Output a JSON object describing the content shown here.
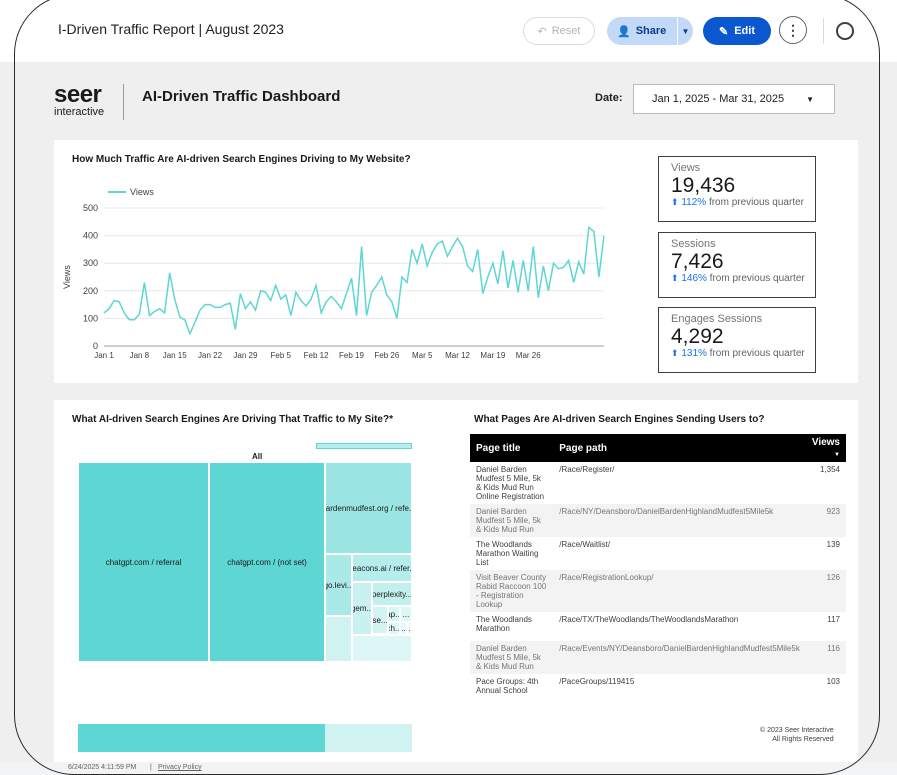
{
  "topbar": {
    "report_title": "I-Driven Traffic Report | August 2023",
    "reset_label": "Reset",
    "share_label": "Share",
    "edit_label": "Edit"
  },
  "header": {
    "logo_main": "seer",
    "logo_sub": "interactive",
    "title": "AI-Driven Traffic Dashboard",
    "date_label": "Date:",
    "date_range": "Jan 1, 2025 - Mar 31, 2025"
  },
  "traffic": {
    "section_title": "How Much Traffic Are AI-driven Search Engines Driving to My Website?"
  },
  "kpis": [
    {
      "label": "Views",
      "value": "19,436",
      "delta": "112%",
      "suffix": " from previous quarter"
    },
    {
      "label": "Sessions",
      "value": "7,426",
      "delta": "146%",
      "suffix": " from previous quarter"
    },
    {
      "label": "Engages Sessions",
      "value": "4,292",
      "delta": "131%",
      "suffix": " from previous quarter"
    }
  ],
  "chart_data": {
    "type": "line",
    "series": [
      {
        "name": "Views",
        "values": [
          120,
          135,
          165,
          160,
          120,
          95,
          95,
          115,
          230,
          110,
          125,
          135,
          120,
          265,
          170,
          105,
          95,
          45,
          85,
          130,
          150,
          150,
          140,
          140,
          150,
          155,
          60,
          190,
          135,
          160,
          130,
          200,
          195,
          165,
          220,
          170,
          185,
          110,
          195,
          165,
          145,
          170,
          220,
          120,
          160,
          180,
          160,
          135,
          190,
          245,
          110,
          360,
          110,
          195,
          220,
          250,
          185,
          160,
          100,
          250,
          230,
          350,
          300,
          370,
          290,
          340,
          370,
          380,
          325,
          360,
          390,
          360,
          290,
          270,
          350,
          190,
          250,
          300,
          225,
          345,
          210,
          310,
          195,
          310,
          200,
          360,
          175,
          290,
          200,
          300,
          280,
          285,
          310,
          230,
          305,
          260,
          430,
          415,
          250,
          400
        ],
        "color": "#5dd6d4"
      }
    ],
    "x_ticks": [
      "Jan 1",
      "Jan 8",
      "Jan 15",
      "Jan 22",
      "Jan 29",
      "Feb 5",
      "Feb 12",
      "Feb 19",
      "Feb 26",
      "Mar 5",
      "Mar 12",
      "Mar 19",
      "Mar 26"
    ],
    "y_ticks": [
      0,
      100,
      200,
      300,
      400,
      500
    ],
    "ylim": [
      0,
      500
    ],
    "ylabel": "Views",
    "legend": "top-left"
  },
  "engines": {
    "section_title": "What AI-driven Search Engines Are Driving That Traffic to My Site?*",
    "all_label": "All",
    "tiles": [
      "chatgpt.com / referral",
      "chatgpt.com / (not set)",
      "bardenmudfest.org / refe...",
      "beacons.ai / refer...",
      "go.levi...",
      "perplexity...",
      "gem...",
      "se...",
      "ap...",
      "...",
      "ch...",
      "|...",
      "..."
    ]
  },
  "pages": {
    "section_title": "What Pages Are AI-driven Search Engines Sending Users to?",
    "columns": [
      "Page title",
      "Page path",
      "Views"
    ],
    "rows": [
      {
        "title": "Daniel Barden Mudfest 5 Mile, 5k & Kids Mud Run Online Registration",
        "path": "/Race/Register/",
        "views": "1,354"
      },
      {
        "title": "Daniel Barden Mudfest 5 Mile, 5k & Kids Mud Run",
        "path": "/Race/NY/Deansboro/DanielBardenHighlandMudfest5Mile5k",
        "views": "923"
      },
      {
        "title": "The Woodlands Marathon Waiting List",
        "path": "/Race/Waitlist/",
        "views": "139"
      },
      {
        "title": "Visit Beaver County Rabid Raccoon 100 - Registration Lookup",
        "path": "/Race/RegistrationLookup/",
        "views": "126"
      },
      {
        "title": "The Woodlands Marathon",
        "path": "/Race/TX/TheWoodlands/TheWoodlandsMarathon",
        "views": "117"
      },
      {
        "title": "Daniel Barden Mudfest 5 Mile, 5k & Kids Mud Run",
        "path": "/Race/Events/NY/Deansboro/DanielBardenHighlandMudfest5Mile5k",
        "views": "116"
      },
      {
        "title": "Pace Groups: 4th Annual School",
        "path": "/PaceGroups/119415",
        "views": "103"
      }
    ]
  },
  "footer": {
    "copyright_1": "© 2023 Seer Interactive",
    "copyright_2": "All Rights Reserved",
    "timestamp": "6/24/2025 4:11:59 PM",
    "privacy": "Privacy Policy"
  }
}
